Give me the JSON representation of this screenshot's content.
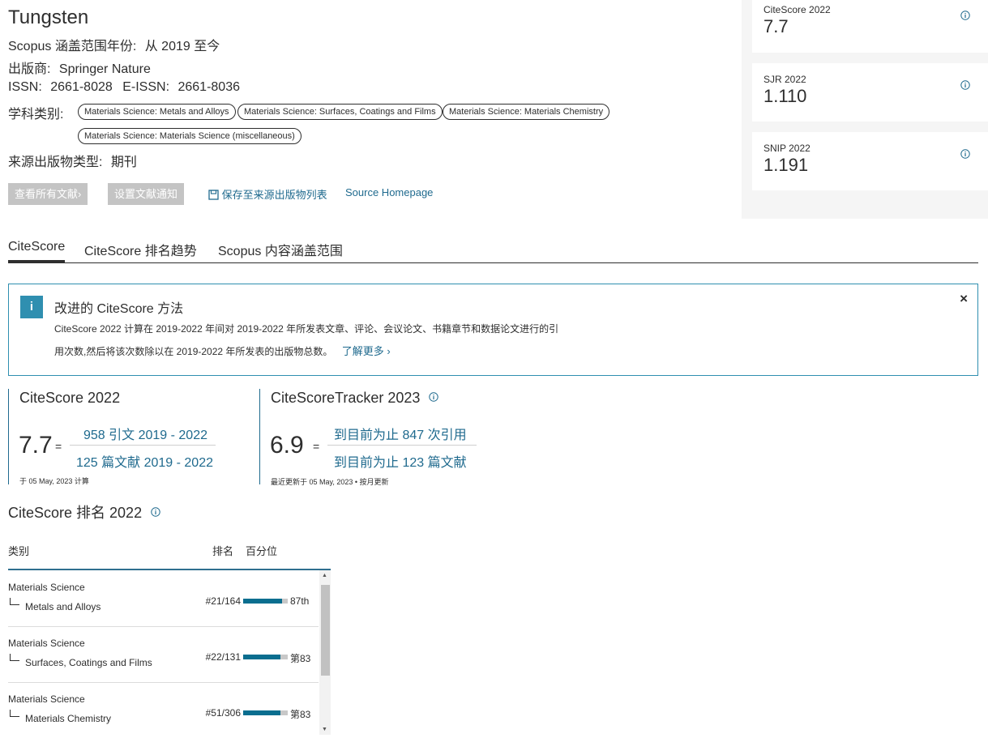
{
  "source": {
    "title": "Tungsten",
    "coverage_label": "Scopus 涵盖范围年份:",
    "coverage_value": "从 2019 至今",
    "publisher_label": "出版商:",
    "publisher_value": "Springer Nature",
    "issn_label": "ISSN:",
    "issn_value": "2661-8028",
    "eissn_label": "E-ISSN:",
    "eissn_value": "2661-8036",
    "subject_label": "学科类别:",
    "subject_tags": [
      "Materials Science: Metals and Alloys",
      "Materials Science: Surfaces, Coatings and Films",
      "Materials Science: Materials Chemistry",
      "Materials Science: Materials Science (miscellaneous)"
    ],
    "type_label": "来源出版物类型:",
    "type_value": "期刊",
    "view_all_button": "查看所有文献",
    "alert_button": "设置文献通知",
    "save_link": "保存至来源出版物列表",
    "homepage_link": "Source Homepage"
  },
  "metrics": [
    {
      "label": "CiteScore 2022",
      "value": "7.7"
    },
    {
      "label": "SJR 2022",
      "value": "1.110"
    },
    {
      "label": "SNIP 2022",
      "value": "1.191"
    }
  ],
  "tabs": [
    "CiteScore",
    "CiteScore 排名趋势",
    "Scopus 内容涵盖范围"
  ],
  "notice": {
    "title": "改进的 CiteScore 方法",
    "body_line1": "CiteScore 2022 计算在 2019-2022 年间对 2019-2022 年所发表文章、评论、会议论文、书籍章节和数据论文进行的引",
    "body_line2": "用次数,然后将该次数除以在 2019-2022 年所发表的出版物总数。",
    "learn_more": "了解更多",
    "close": "×",
    "info_glyph": "i"
  },
  "citescore": {
    "title": "CiteScore 2022",
    "value": "7.7",
    "equals": "=",
    "numerator": "958 引文 2019 - 2022",
    "denominator": "125 篇文献 2019 - 2022",
    "calc_date": "于 05 May, 2023 计算"
  },
  "tracker": {
    "title": "CiteScoreTracker 2023",
    "value": "6.9",
    "equals": "=",
    "numerator": "到目前为止 847 次引用",
    "denominator": "到目前为止 123 篇文献",
    "update_note": "最近更新于 05 May, 2023 • 按月更新"
  },
  "ranking": {
    "title": "CiteScore 排名 2022",
    "col_category": "类别",
    "col_rank": "排名",
    "col_percentile": "百分位",
    "rows": [
      {
        "category": "Materials Science",
        "subcategory": "Metals and Alloys",
        "rank": "#21/164",
        "percentile_label": "87th",
        "percentile": 87
      },
      {
        "category": "Materials Science",
        "subcategory": "Surfaces, Coatings and Films",
        "rank": "#22/131",
        "percentile_label": "第83",
        "percentile": 83
      },
      {
        "category": "Materials Science",
        "subcategory": "Materials Chemistry",
        "rank": "#51/306",
        "percentile_label": "第83",
        "percentile": 83
      }
    ]
  },
  "colors": {
    "accent": "#1f6a8e",
    "bar": "#0a6e8f",
    "border": "#2f8fb0"
  }
}
